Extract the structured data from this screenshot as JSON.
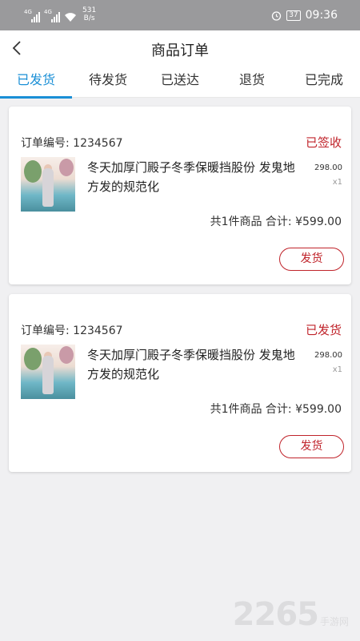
{
  "status_bar": {
    "signal1_tag": "4G",
    "signal2_tag": "4G",
    "net_speed_value": "531",
    "net_speed_unit": "B/s",
    "battery": "37",
    "time": "09:36"
  },
  "header": {
    "title": "商品订单",
    "back_icon": "chevron-left-icon"
  },
  "tabs": [
    {
      "label": "已发货",
      "active": true
    },
    {
      "label": "待发货",
      "active": false
    },
    {
      "label": "已送达",
      "active": false
    },
    {
      "label": "退货",
      "active": false
    },
    {
      "label": "已完成",
      "active": false
    }
  ],
  "orders": [
    {
      "order_no": "订单编号: 1234567",
      "status": "已签收",
      "product_name": "冬天加厚门殿子冬季保暖挡股份 发鬼地方发的规范化",
      "price": "298.00",
      "quantity": "x1",
      "total": "共1件商品 合计: ¥599.00",
      "action_label": "发货"
    },
    {
      "order_no": "订单编号: 1234567",
      "status": "已发货",
      "product_name": "冬天加厚门殿子冬季保暖挡股份 发鬼地方发的规范化",
      "price": "298.00",
      "quantity": "x1",
      "total": "共1件商品 合计: ¥599.00",
      "action_label": "发货"
    }
  ],
  "watermark": {
    "number": "2265",
    "text": "手游网"
  },
  "colors": {
    "accent": "#1a8fd6",
    "status_red": "#c0242b",
    "background": "#f0f0f2"
  }
}
